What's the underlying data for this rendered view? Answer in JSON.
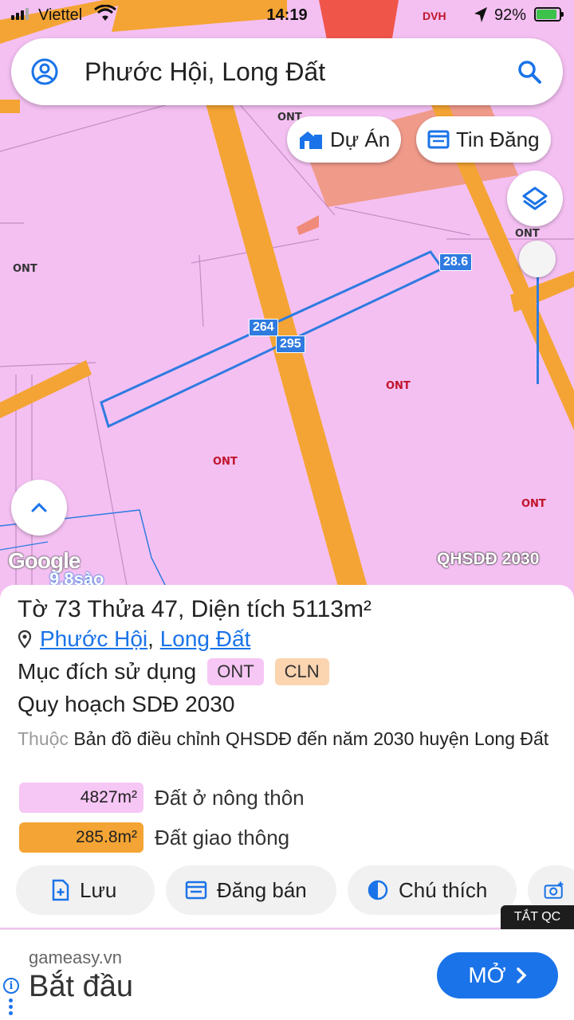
{
  "status_bar": {
    "carrier": "Viettel",
    "time": "14:19",
    "extra": "DVH",
    "battery": "92%",
    "battery_level": 0.92
  },
  "search": {
    "query": "Phước Hội, Long Đất",
    "icons": [
      "user-circle-icon",
      "search-icon"
    ]
  },
  "map_buttons": {
    "du_an": "Dự Án",
    "tin_dang": "Tin Đăng"
  },
  "map": {
    "zone_labels": [
      "ONT",
      "ONT",
      "ONT",
      "ONT",
      "ONT",
      "ONT"
    ],
    "dimensions": [
      "28.6",
      "264",
      "295"
    ],
    "google": "Google",
    "overlay_name": "QHSDĐ 2030",
    "area_sao": "9.8sào",
    "colors": {
      "land": "#f4c0f2",
      "road": "#f4a434",
      "boundary": "#2f7be0",
      "urban": "#f08080"
    }
  },
  "parcel": {
    "to_label": "Tờ",
    "to_value": "73",
    "thua_label": "Thửa",
    "thua_value": "47",
    "dien_tich_label": ", Diện tích",
    "area_value": "5113",
    "area_unit": "m²",
    "ward": "Phước Hội",
    "district": "Long Đất",
    "purpose_label": "Mục đích sử dụng",
    "purpose_tags": [
      "ONT",
      "CLN"
    ],
    "plan_title": "Quy hoạch SDĐ 2030",
    "plan_prefix": "Thuộc",
    "plan_desc": "Bản đồ điều chỉnh QHSDĐ đến năm 2030 huyện Long Đất",
    "areas": [
      {
        "value": "4827m²",
        "label": "Đất ở nông thôn",
        "color": "#f6c6f5"
      },
      {
        "value": "285.8m²",
        "label": "Đất giao thông",
        "color": "#f4a434"
      }
    ]
  },
  "actions": {
    "save": "Lưu",
    "sell": "Đăng bán",
    "legend": "Chú thích"
  },
  "ad": {
    "close_label": "TẮT QC",
    "domain": "gameasy.vn",
    "title": "Bắt đầu",
    "button": "MỞ"
  }
}
